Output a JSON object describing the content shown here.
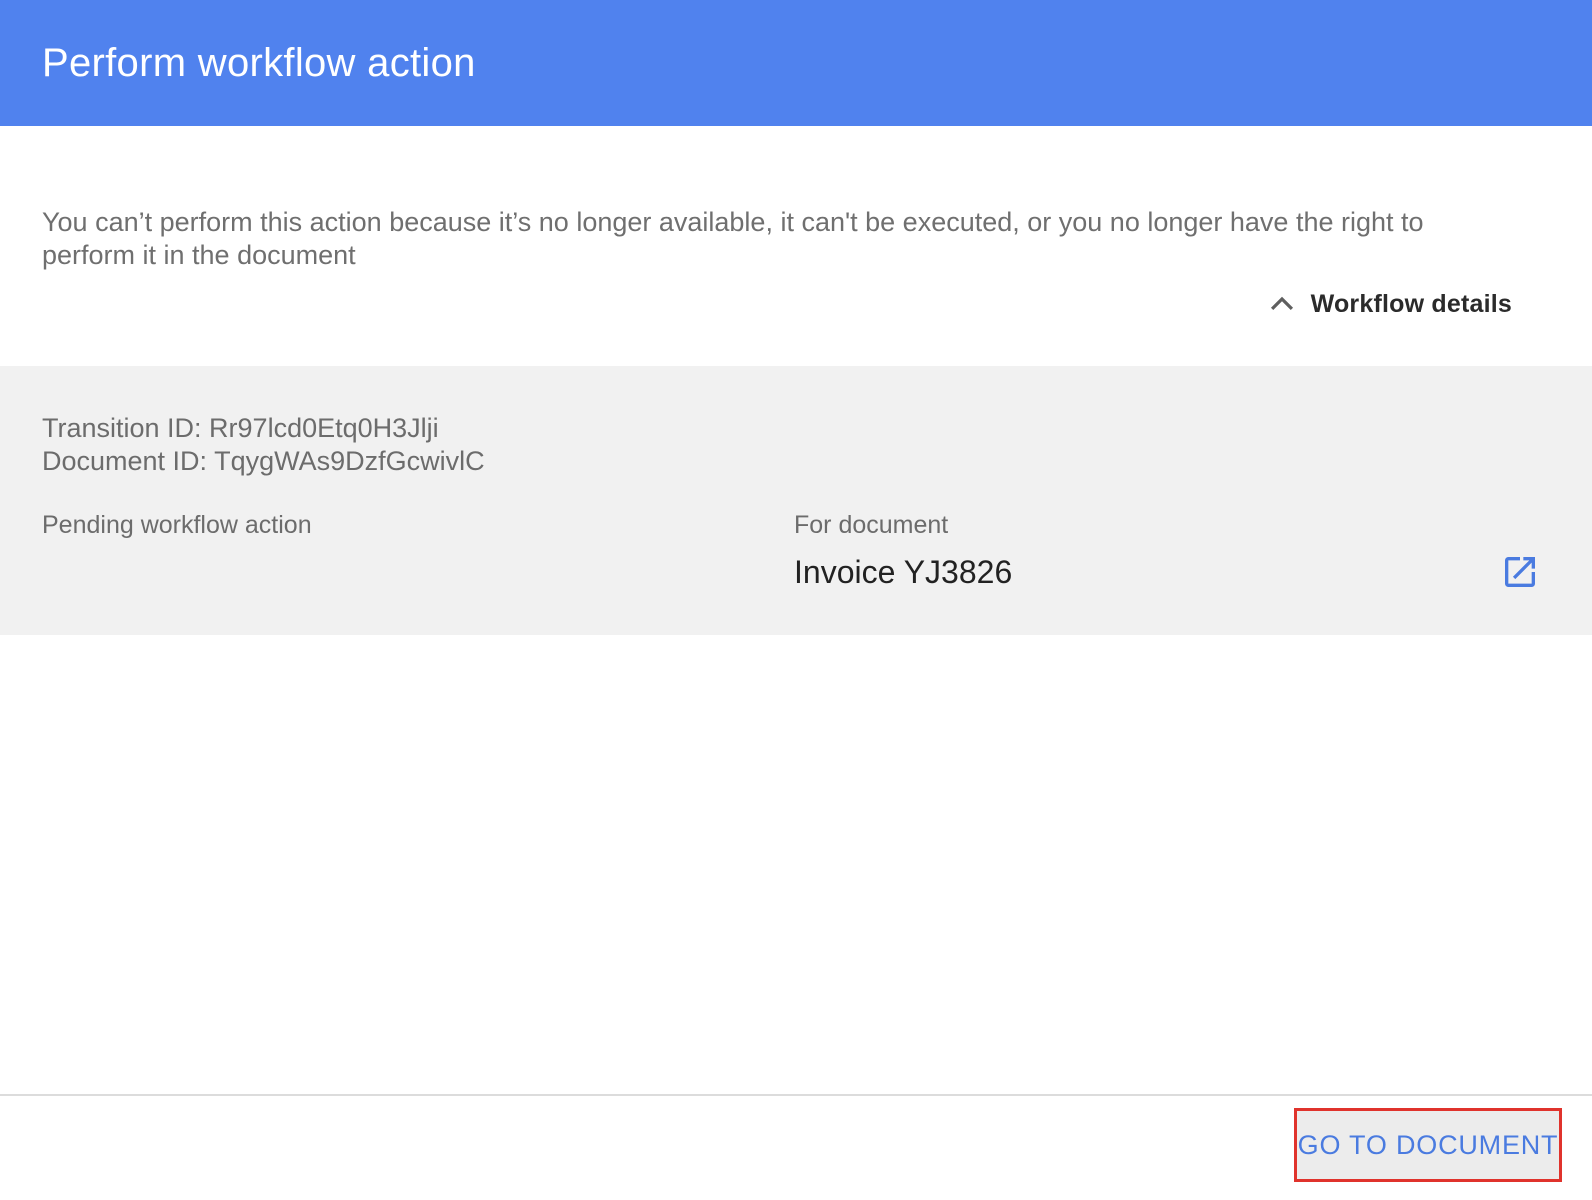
{
  "header": {
    "title": "Perform workflow action",
    "color": "#5082ee"
  },
  "message": "You can’t perform this action because it’s no longer available, it can't be executed, or you no longer have the right to perform it in the document",
  "details_toggle": {
    "label": "Workflow details",
    "icon": "chevron-up-icon",
    "expanded": true
  },
  "details": {
    "transition_id": "Transition ID: Rr97lcd0Etq0H3Jlji",
    "document_id": "Document ID: TqygWAs9DzfGcwivlC",
    "pending_label": "Pending workflow action",
    "for_document_label": "For document",
    "document_name": "Invoice YJ3826",
    "open_icon": "open-in-new-icon"
  },
  "footer": {
    "go_button_label": "GO TO DOCUMENT",
    "highlight_color": "#e0332c",
    "accent_color": "#4a7be0"
  }
}
